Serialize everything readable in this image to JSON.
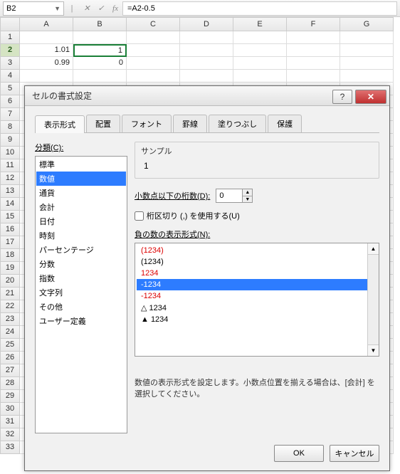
{
  "formula_bar": {
    "cell_ref": "B2",
    "formula": "=A2-0.5"
  },
  "grid": {
    "cols": [
      "A",
      "B",
      "C",
      "D",
      "E",
      "F",
      "G"
    ],
    "rows": [
      {
        "n": "1",
        "cells": [
          "",
          "",
          "",
          "",
          "",
          "",
          ""
        ]
      },
      {
        "n": "2",
        "cells": [
          "1.01",
          "1",
          "",
          "",
          "",
          "",
          ""
        ],
        "active": true,
        "sel_col": 1
      },
      {
        "n": "3",
        "cells": [
          "0.99",
          "0",
          "",
          "",
          "",
          "",
          ""
        ]
      },
      {
        "n": "4",
        "cells": [
          "",
          "",
          "",
          "",
          "",
          "",
          ""
        ]
      },
      {
        "n": "5",
        "cells": [
          "",
          "",
          "",
          "",
          "",
          "",
          ""
        ]
      },
      {
        "n": "6",
        "cells": [
          "",
          "",
          "",
          "",
          "",
          "",
          ""
        ]
      },
      {
        "n": "7",
        "cells": [
          "",
          "",
          "",
          "",
          "",
          "",
          ""
        ]
      },
      {
        "n": "8",
        "cells": [
          "",
          "",
          "",
          "",
          "",
          "",
          ""
        ]
      },
      {
        "n": "9",
        "cells": [
          "",
          "",
          "",
          "",
          "",
          "",
          ""
        ]
      },
      {
        "n": "10",
        "cells": [
          "",
          "",
          "",
          "",
          "",
          "",
          ""
        ]
      },
      {
        "n": "11",
        "cells": [
          "",
          "",
          "",
          "",
          "",
          "",
          ""
        ]
      },
      {
        "n": "12",
        "cells": [
          "",
          "",
          "",
          "",
          "",
          "",
          ""
        ]
      },
      {
        "n": "13",
        "cells": [
          "",
          "",
          "",
          "",
          "",
          "",
          ""
        ]
      },
      {
        "n": "14",
        "cells": [
          "",
          "",
          "",
          "",
          "",
          "",
          ""
        ]
      },
      {
        "n": "15",
        "cells": [
          "",
          "",
          "",
          "",
          "",
          "",
          ""
        ]
      },
      {
        "n": "16",
        "cells": [
          "",
          "",
          "",
          "",
          "",
          "",
          ""
        ]
      },
      {
        "n": "17",
        "cells": [
          "",
          "",
          "",
          "",
          "",
          "",
          ""
        ]
      },
      {
        "n": "18",
        "cells": [
          "",
          "",
          "",
          "",
          "",
          "",
          ""
        ]
      },
      {
        "n": "19",
        "cells": [
          "",
          "",
          "",
          "",
          "",
          "",
          ""
        ]
      },
      {
        "n": "20",
        "cells": [
          "",
          "",
          "",
          "",
          "",
          "",
          ""
        ]
      },
      {
        "n": "21",
        "cells": [
          "",
          "",
          "",
          "",
          "",
          "",
          ""
        ]
      },
      {
        "n": "22",
        "cells": [
          "",
          "",
          "",
          "",
          "",
          "",
          ""
        ]
      },
      {
        "n": "23",
        "cells": [
          "",
          "",
          "",
          "",
          "",
          "",
          ""
        ]
      },
      {
        "n": "24",
        "cells": [
          "",
          "",
          "",
          "",
          "",
          "",
          ""
        ]
      },
      {
        "n": "25",
        "cells": [
          "",
          "",
          "",
          "",
          "",
          "",
          ""
        ]
      },
      {
        "n": "26",
        "cells": [
          "",
          "",
          "",
          "",
          "",
          "",
          ""
        ]
      },
      {
        "n": "27",
        "cells": [
          "",
          "",
          "",
          "",
          "",
          "",
          ""
        ]
      },
      {
        "n": "28",
        "cells": [
          "",
          "",
          "",
          "",
          "",
          "",
          ""
        ]
      },
      {
        "n": "29",
        "cells": [
          "",
          "",
          "",
          "",
          "",
          "",
          ""
        ]
      },
      {
        "n": "30",
        "cells": [
          "",
          "",
          "",
          "",
          "",
          "",
          ""
        ]
      },
      {
        "n": "31",
        "cells": [
          "",
          "",
          "",
          "",
          "",
          "",
          ""
        ]
      },
      {
        "n": "32",
        "cells": [
          "",
          "",
          "",
          "",
          "",
          "",
          ""
        ]
      },
      {
        "n": "33",
        "cells": [
          "",
          "",
          "",
          "",
          "",
          "",
          ""
        ]
      }
    ]
  },
  "dialog": {
    "title": "セルの書式設定",
    "help": "?",
    "close": "✕",
    "tabs": [
      "表示形式",
      "配置",
      "フォント",
      "罫線",
      "塗りつぶし",
      "保護"
    ],
    "active_tab": 0,
    "category_label": "分類(C):",
    "categories": [
      "標準",
      "数値",
      "通貨",
      "会計",
      "日付",
      "時刻",
      "パーセンテージ",
      "分数",
      "指数",
      "文字列",
      "その他",
      "ユーザー定義"
    ],
    "selected_category": 1,
    "sample_label": "サンプル",
    "sample_value": "1",
    "decimal_label": "小数点以下の桁数(D):",
    "decimal_value": "0",
    "thousands_label": "桁区切り (,) を使用する(U)",
    "negative_label": "負の数の表示形式(N):",
    "negative_formats": [
      {
        "text": "(1234)",
        "cls": "red"
      },
      {
        "text": "(1234)",
        "cls": ""
      },
      {
        "text": "1234",
        "cls": "red"
      },
      {
        "text": "-1234",
        "cls": "sel"
      },
      {
        "text": "-1234",
        "cls": "red"
      },
      {
        "text": "△ 1234",
        "cls": ""
      },
      {
        "text": "▲ 1234",
        "cls": ""
      }
    ],
    "description": "数値の表示形式を設定します。小数点位置を揃える場合は、[会計] を選択してください。",
    "ok": "OK",
    "cancel": "キャンセル"
  }
}
